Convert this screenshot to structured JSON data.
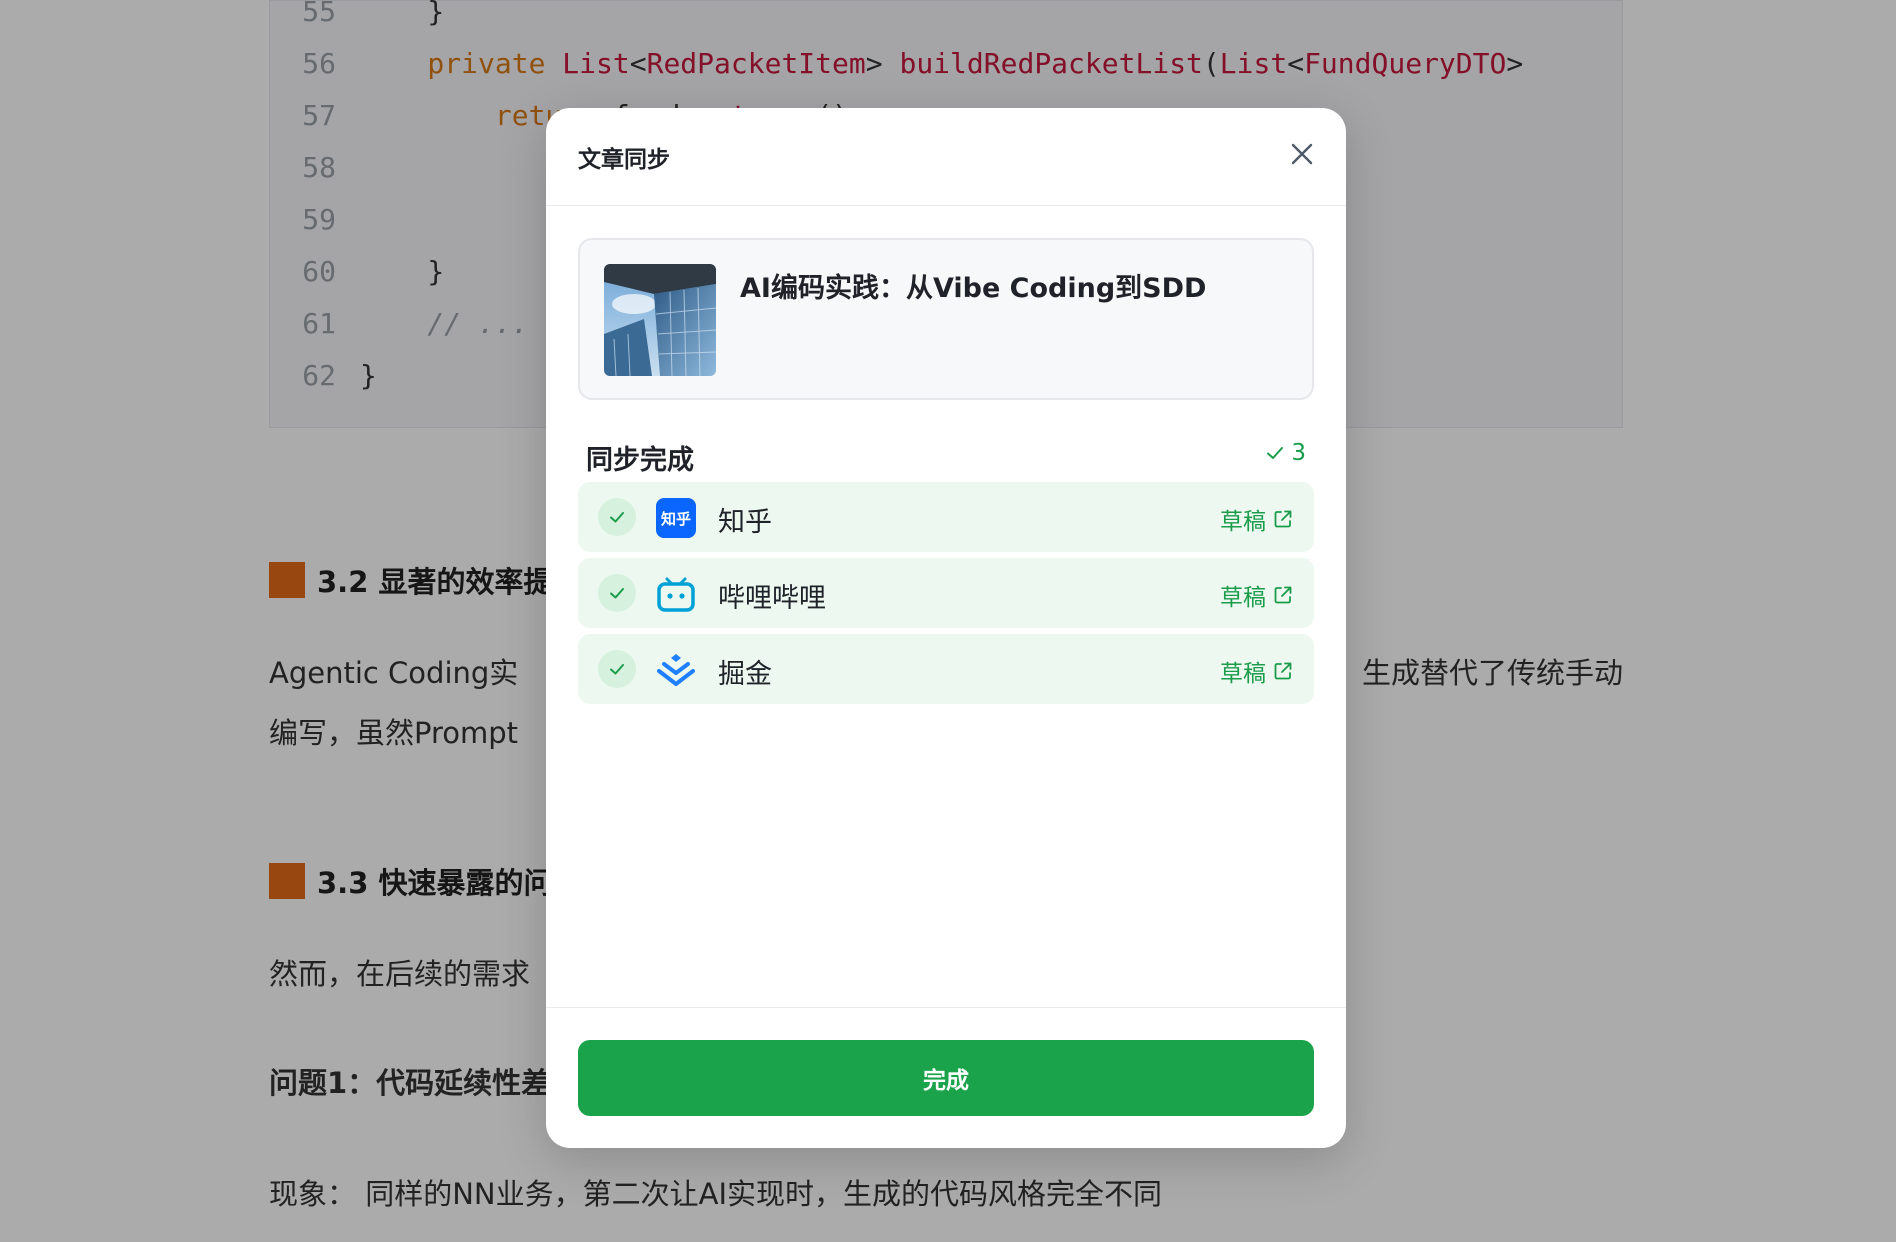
{
  "code": {
    "lines": [
      {
        "num": "55",
        "tokens": [
          {
            "t": "    }",
            "c": "pl"
          }
        ]
      },
      {
        "num": "56",
        "tokens": [
          {
            "t": "    private ",
            "c": "kw"
          },
          {
            "t": "List",
            "c": "ty"
          },
          {
            "t": "<",
            "c": "pl"
          },
          {
            "t": "RedPacketItem",
            "c": "ty"
          },
          {
            "t": "> ",
            "c": "pl"
          },
          {
            "t": "buildRedPacketList",
            "c": "fn"
          },
          {
            "t": "(",
            "c": "pl"
          },
          {
            "t": "List",
            "c": "ty"
          },
          {
            "t": "<",
            "c": "pl"
          },
          {
            "t": "FundQueryDTO",
            "c": "ty"
          },
          {
            "t": ">",
            "c": "pl"
          }
        ]
      },
      {
        "num": "57",
        "tokens": [
          {
            "t": "        return",
            "c": "kw"
          },
          {
            "t": " funds.",
            "c": "pl"
          },
          {
            "t": "stream",
            "c": "fn"
          },
          {
            "t": "()",
            "c": "pl"
          }
        ]
      },
      {
        "num": "58",
        "tokens": [
          {
            "t": "",
            "c": "pl"
          }
        ]
      },
      {
        "num": "59",
        "tokens": [
          {
            "t": "",
            "c": "pl"
          }
        ]
      },
      {
        "num": "60",
        "tokens": [
          {
            "t": "    }",
            "c": "pl"
          }
        ]
      },
      {
        "num": "61",
        "tokens": [
          {
            "t": "    // ...",
            "c": "cm"
          }
        ]
      },
      {
        "num": "62",
        "tokens": [
          {
            "t": "}",
            "c": "pl"
          }
        ]
      }
    ]
  },
  "article": {
    "heading_32": "3.2 显著的效率提",
    "para_1_line_1_left": "Agentic Coding实",
    "para_1_line_1_right": "生成替代了传统手动",
    "para_1_line_2": "编写，虽然Prompt",
    "heading_33": "3.3 快速暴露的问",
    "para_2": "然而，在后续的需求",
    "problem_1": "问题1：代码延续性差",
    "phenomenon": "现象：  同样的NN业务，第二次让AI实现时，生成的代码风格完全不同"
  },
  "modal": {
    "title": "文章同步",
    "article_title": "AI编码实践：从Vibe Coding到SDD",
    "status_label": "同步完成",
    "success_count": "3",
    "platforms": [
      {
        "name": "知乎",
        "logo_text": "知乎",
        "status": "草稿",
        "icon": "zhihu-logo-icon"
      },
      {
        "name": "哔哩哔哩",
        "status": "草稿",
        "icon": "bilibili-logo-icon"
      },
      {
        "name": "掘金",
        "status": "草稿",
        "icon": "juejin-logo-icon"
      }
    ],
    "done_label": "完成"
  },
  "colors": {
    "accent_green": "#1aa34a",
    "success_text": "#1a9c4b",
    "row_bg": "#edf8f0",
    "zhihu_blue": "#0a66ff",
    "bilibili_blue": "#00a1d6",
    "juejin_blue": "#1e80ff",
    "heading_marker": "#e56a1a"
  }
}
